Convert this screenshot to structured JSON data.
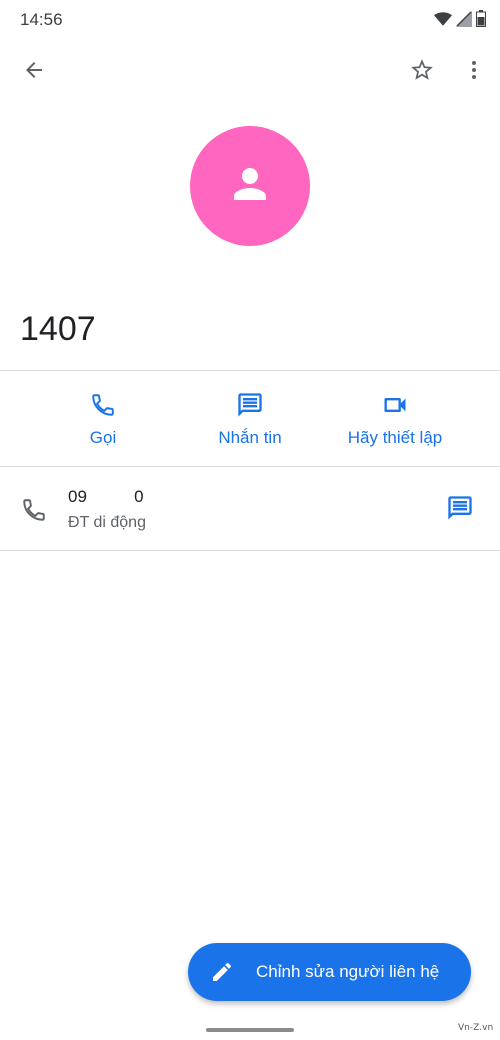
{
  "status_bar": {
    "time": "14:56",
    "icons": [
      "wifi-icon",
      "signal-icon",
      "battery-icon"
    ]
  },
  "app_bar": {
    "icons": [
      "arrow-back-icon",
      "star-outline-icon",
      "more-vert-icon"
    ]
  },
  "contact": {
    "name": "1407",
    "avatar_color": "#ff66bf",
    "avatar_icon": "person-icon"
  },
  "actions": [
    {
      "label": "Gọi",
      "icon": "phone-icon"
    },
    {
      "label": "Nhắn tin",
      "icon": "message-icon"
    },
    {
      "label": "Hãy thiết lập",
      "icon": "videocam-icon"
    }
  ],
  "phone": {
    "number": "09          0",
    "type": "ĐT di động",
    "icon": "phone-icon",
    "action_icon": "message-icon"
  },
  "fab": {
    "label": "Chỉnh sửa người liên hệ",
    "icon": "edit-pencil-icon"
  },
  "watermark": "Vn-Z.vn",
  "colors": {
    "accent": "#1a73e8",
    "avatar": "#ff66bf",
    "text_primary": "#202124",
    "text_secondary": "#5f6368",
    "divider": "#dadce0"
  }
}
